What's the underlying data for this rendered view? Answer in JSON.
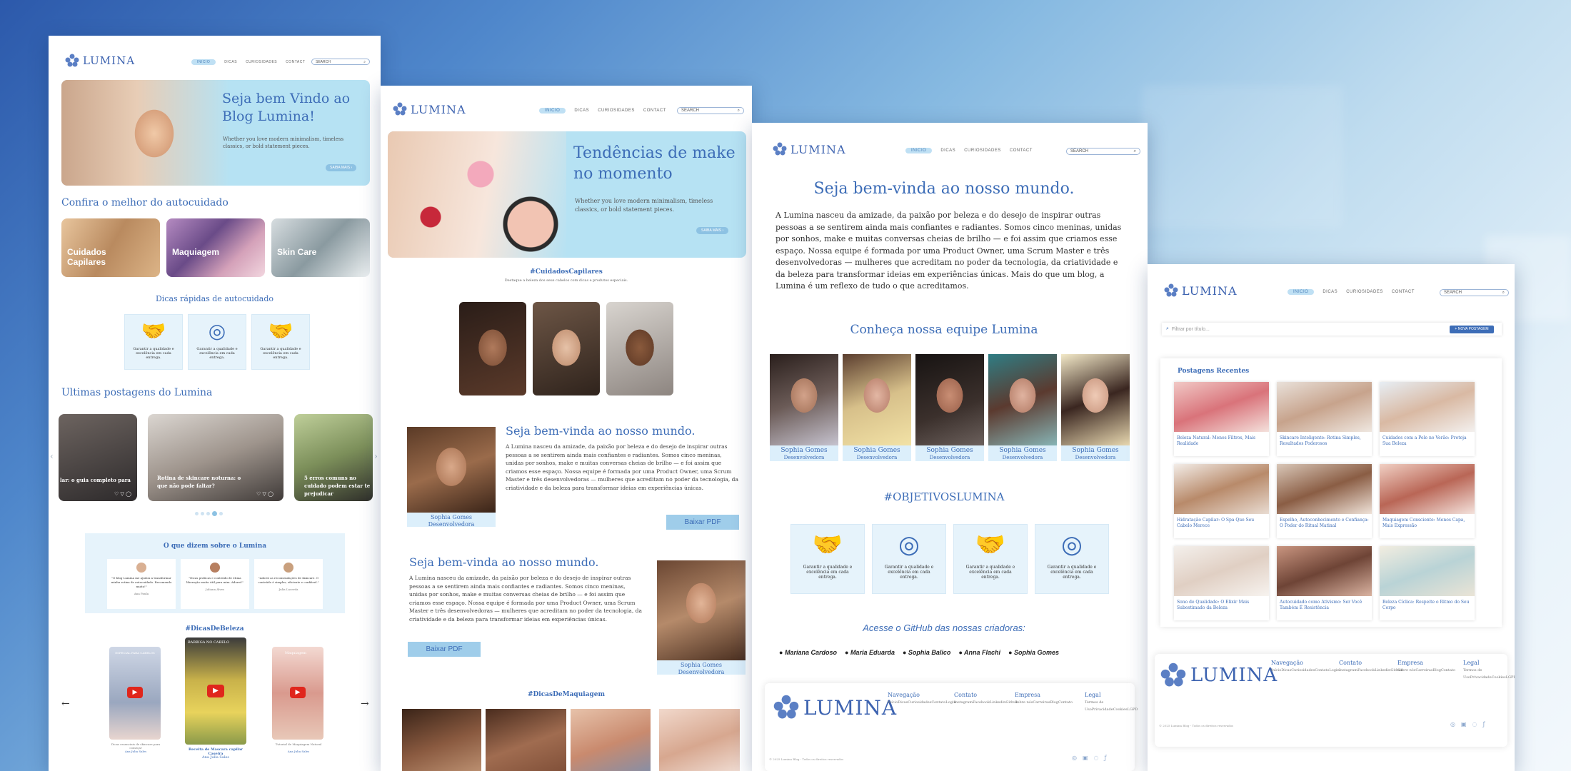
{
  "brand": {
    "logo_text": "LUMINA",
    "colors": {
      "primary": "#3d6db7",
      "pill": "#bfe0f4",
      "hero_bg": "#b6e2f3",
      "soft_bg": "#e6f3fb"
    }
  },
  "nav": {
    "items": [
      "INICIO",
      "DICAS",
      "CURIOSIDADES",
      "CONTACT"
    ],
    "search_placeholder": "SEARCH"
  },
  "page1": {
    "hero_title": "Seja bem Vindo ao Blog Lumina!",
    "hero_text": "Whether you love modern minimalism, timeless classics, or bold statement pieces.",
    "hero_button": "SAIBA MAIS",
    "section_title": "Confira o melhor do autocuidado",
    "categories": [
      "Cuidados Capilares",
      "Maquiagem",
      "Skin Care"
    ],
    "tips_title": "Dicas rápidas de autocuidado",
    "tips": [
      "Garantir a qualidade e excelência em cada entrega.",
      "Garantir a qualidade e excelência em cada entrega.",
      "Garantir a qualidade e excelência em cada entrega."
    ],
    "posts_title": "Ultimas postagens do Lumina",
    "posts": [
      "lar: o guia completo para",
      "Rotina de skincare noturna: o que não pode faltar?",
      "5 erros comuns no cuidado podem estar te prejudicar"
    ],
    "testimonials_title": "O que dizem sobre o Lumina",
    "testimonials": [
      {
        "quote": "\"O blog Lumina me ajudou a transformar minha rotina de autocuidado. Recomendo muito!\"",
        "name": "Ana Paula"
      },
      {
        "quote": "\"Dicas práticas e conteúdo de ótima liberação muito útil para mim. Adorei!\"",
        "name": "Juliana Alves"
      },
      {
        "quote": "\"Adorei as recomendações de skincare. O conteúdo é simples, eficiente e confiável.\"",
        "name": "Julia Lacerda"
      }
    ],
    "reels_title": "#DicasDeBeleza",
    "reels": [
      {
        "overlay": "ESPECIAL PARA CABELOS",
        "caption": "Dicas essenciais de skincare para começar",
        "author": "Ana Julia Sales"
      },
      {
        "overlay": "BARBIGA NO CABELO",
        "caption": "Receita de Mascara capilar Caseira",
        "author": "Ana Julia Sales"
      },
      {
        "overlay": "Maquiagem",
        "caption": "Tutorial de Maquiagem Natural",
        "author": "Ana Julia Sales"
      }
    ],
    "arrows": [
      "←",
      "→"
    ]
  },
  "page2": {
    "hero_title": "Tendências de make no momento",
    "hero_text": "Whether you love modern minimalism, timeless classics, or bold statement pieces.",
    "hero_button": "SAIBA MAIS",
    "hashtag1": "#CuidadosCapilares",
    "hashtag1_sub": "Destaque a beleza dos seus cabelos com dicas e produtos especiais.",
    "about_title": "Seja bem-vinda ao nosso mundo.",
    "about_text": "A Lumina nasceu da amizade, da paixão por beleza e do desejo de inspirar outras pessoas a se sentirem ainda mais confiantes e radiantes. Somos cinco meninas, unidas por sonhos, make e muitas conversas cheias de brilho — e foi assim que criamos esse espaço. Nossa equipe é formada por uma Product Owner, uma Scrum Master e três desenvolvedoras — mulheres que acreditam no poder da tecnologia, da criatividade e da beleza para transformar ideias em experiências únicas.",
    "person_name": "Sophia Gomes",
    "person_role": "Desenvolvedora",
    "pdf_button": "Baixar PDF",
    "hashtag2": "#DicasDeMaquiagem"
  },
  "page3": {
    "title": "Seja bem-vinda ao nosso mundo.",
    "text": "A Lumina nasceu da amizade, da paixão por beleza e do desejo de inspirar outras pessoas a se sentirem ainda mais confiantes e radiantes. Somos cinco meninas, unidas por sonhos, make e muitas conversas cheias de brilho — e foi assim que criamos esse espaço. Nossa equipe é formada por uma Product Owner, uma Scrum Master e três desenvolvedoras — mulheres que acreditam no poder da tecnologia, da criatividade e da beleza para transformar ideias em experiências únicas. Mais do que um blog, a Lumina é um reflexo de tudo o que acreditamos.",
    "team_title": "Conheça nossa equipe Lumina",
    "team": [
      "Sophia Gomes",
      "Sophia Gomes",
      "Sophia Gomes",
      "Sophia Gomes",
      "Sophia Gomes"
    ],
    "team_role": "Desenvolvedora",
    "goals_title": "#OBJETIVOSLUMINA",
    "goals": [
      "Garantir a qualidade e excelência em cada entrega.",
      "Garantir a qualidade e excelência em cada entrega.",
      "Garantir a qualidade e excelência em cada entrega.",
      "Garantir a qualidade e excelência em cada entrega."
    ],
    "github_title": "Acesse o GitHub das nossas criadoras:",
    "github": [
      "Mariana Cardoso",
      "Maria Eduarda",
      "Sophia Balico",
      "Anna Flachi",
      "Sophia Gomes"
    ]
  },
  "page4": {
    "filter_placeholder": "Filtrar por título...",
    "new_post": "+ NOVA POSTAGEM",
    "recent_title": "Postagens Recentes",
    "posts": [
      "Beleza Natural: Menos Filtros, Mais Realidade",
      "Skincare Inteligente: Rotina Simples, Resultados Poderosos",
      "Cuidados com a Pele no Verão: Proteja Sua Beleza",
      "Hidratação Capilar: O Spa Que Seu Cabelo Merece",
      "Espelho, Autoconhecimento e Confiança: O Poder do Ritual Matinal",
      "Maquiagem Consciente: Menos Capa, Mais Expressão",
      "Sono de Qualidade: O Elixir Mais Subestimado da Beleza",
      "Autocuidado como Ativismo: Ser Você Também É Resistência",
      "Beleza Cíclica: Respeite o Ritmo do Seu Corpo"
    ]
  },
  "footer": {
    "columns": [
      {
        "title": "Navegação",
        "links": [
          "Início",
          "Dicas",
          "Curiosidades",
          "Contato",
          "Login"
        ]
      },
      {
        "title": "Contato",
        "links": [
          "Instagram",
          "Facebook",
          "Linkedin",
          "Github"
        ]
      },
      {
        "title": "Empresa",
        "links": [
          "Sobre nós",
          "Carreiras",
          "Blog",
          "Contato"
        ]
      },
      {
        "title": "Legal",
        "links": [
          "Termos de Uso",
          "Privacidade",
          "Cookies",
          "LGPD"
        ]
      }
    ],
    "copyright": "© 2025 Lumina Blog - Todos os direitos reservados"
  }
}
